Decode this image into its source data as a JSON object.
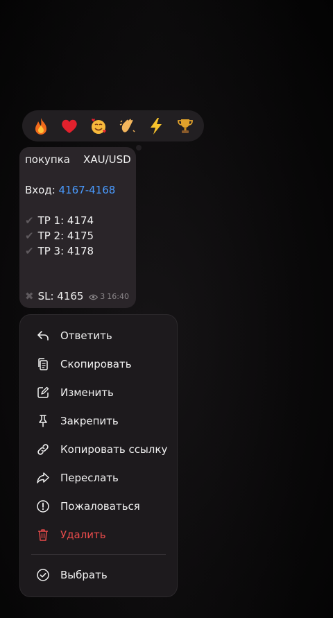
{
  "reactions": [
    {
      "name": "fire",
      "glyph": "🔥"
    },
    {
      "name": "heart",
      "glyph": "❤"
    },
    {
      "name": "smiling-hearts",
      "glyph": "🥰"
    },
    {
      "name": "clapping",
      "glyph": "👏"
    },
    {
      "name": "lightning",
      "glyph": "⚡"
    },
    {
      "name": "trophy",
      "glyph": "🏆"
    }
  ],
  "message": {
    "line1": "покупка    XAU/USD",
    "entry_label": "Вход: ",
    "entry_value": "4167-4168",
    "tp1": "TP 1: 4174",
    "tp2": "TP 2: 4175",
    "tp3": "TP 3: 4178",
    "sl": "SL: 4165",
    "views": "3",
    "time": "16:40"
  },
  "menu": {
    "reply": "Ответить",
    "copy": "Скопировать",
    "edit": "Изменить",
    "pin": "Закрепить",
    "copy_link": "Копировать ссылку",
    "forward": "Переслать",
    "report": "Пожаловаться",
    "delete": "Удалить",
    "select": "Выбрать"
  },
  "colors": {
    "link": "#4a9bff",
    "danger": "#ea4b4b",
    "bubble": "#2a2529",
    "menu": "#1d1a1d"
  }
}
